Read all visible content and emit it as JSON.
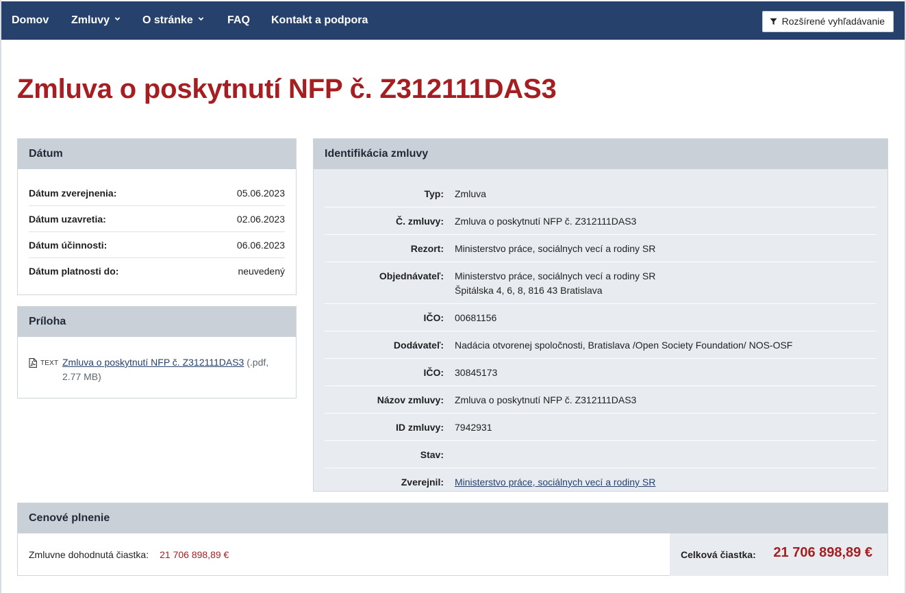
{
  "nav": {
    "items": [
      {
        "label": "Domov",
        "dropdown": false
      },
      {
        "label": "Zmluvy",
        "dropdown": true
      },
      {
        "label": "O stránke",
        "dropdown": true
      },
      {
        "label": "FAQ",
        "dropdown": false
      },
      {
        "label": "Kontakt a podpora",
        "dropdown": false
      }
    ],
    "advanced_search_label": "Rozšírené vyhľadávanie",
    "advanced_search_icon": "filter-icon"
  },
  "page_title": "Zmluva o poskytnutí NFP č. Z312111DAS3",
  "datum": {
    "heading": "Dátum",
    "rows": [
      {
        "label": "Dátum zverejnenia:",
        "value": "05.06.2023"
      },
      {
        "label": "Dátum uzavretia:",
        "value": "02.06.2023"
      },
      {
        "label": "Dátum účinnosti:",
        "value": "06.06.2023"
      },
      {
        "label": "Dátum platnosti do:",
        "value": "neuvedený"
      }
    ]
  },
  "priloha": {
    "heading": "Príloha",
    "attachment": {
      "icon": "pdf-file-icon",
      "type_tag": "TEXT",
      "name": "Zmluva o poskytnutí NFP č. Z312111DAS3",
      "meta": "(.pdf, 2.77 MB)"
    }
  },
  "ident": {
    "heading": "Identifikácia zmluvy",
    "rows": [
      {
        "label": "Typ:",
        "value": "Zmluva"
      },
      {
        "label": "Č. zmluvy:",
        "value": "Zmluva o poskytnutí NFP č. Z312111DAS3"
      },
      {
        "label": "Rezort:",
        "value": "Ministerstvo práce, sociálnych vecí a rodiny SR"
      },
      {
        "label": "Objednávateľ:",
        "value": "Ministerstvo práce, sociálnych vecí a rodiny SR",
        "value2": "Špitálska 4, 6, 8, 816 43 Bratislava"
      },
      {
        "label": "IČO:",
        "value": "00681156"
      },
      {
        "label": "Dodávateľ:",
        "value": "Nadácia otvorenej spoločnosti, Bratislava /Open Society Foundation/ NOS-OSF"
      },
      {
        "label": "IČO:",
        "value": "30845173"
      },
      {
        "label": "Názov zmluvy:",
        "value": "Zmluva o poskytnutí NFP č. Z312111DAS3"
      },
      {
        "label": "ID zmluvy:",
        "value": "7942931"
      },
      {
        "label": "Stav:",
        "value": ""
      },
      {
        "label": "Zverejnil:",
        "value": "Ministerstvo práce, sociálnych vecí a rodiny SR",
        "link": true
      }
    ]
  },
  "cena": {
    "heading": "Cenové plnenie",
    "agreed_label": "Zmluvne dohodnutá čiastka:",
    "agreed_amount": "21 706 898,89 €",
    "total_label": "Celková čiastka:",
    "total_amount": "21 706 898,89 €"
  },
  "colors": {
    "navbar": "#26416b",
    "title_red": "#a51e22",
    "panel_header": "#c9d0d8",
    "panel_body_alt": "#e8ecf0"
  }
}
